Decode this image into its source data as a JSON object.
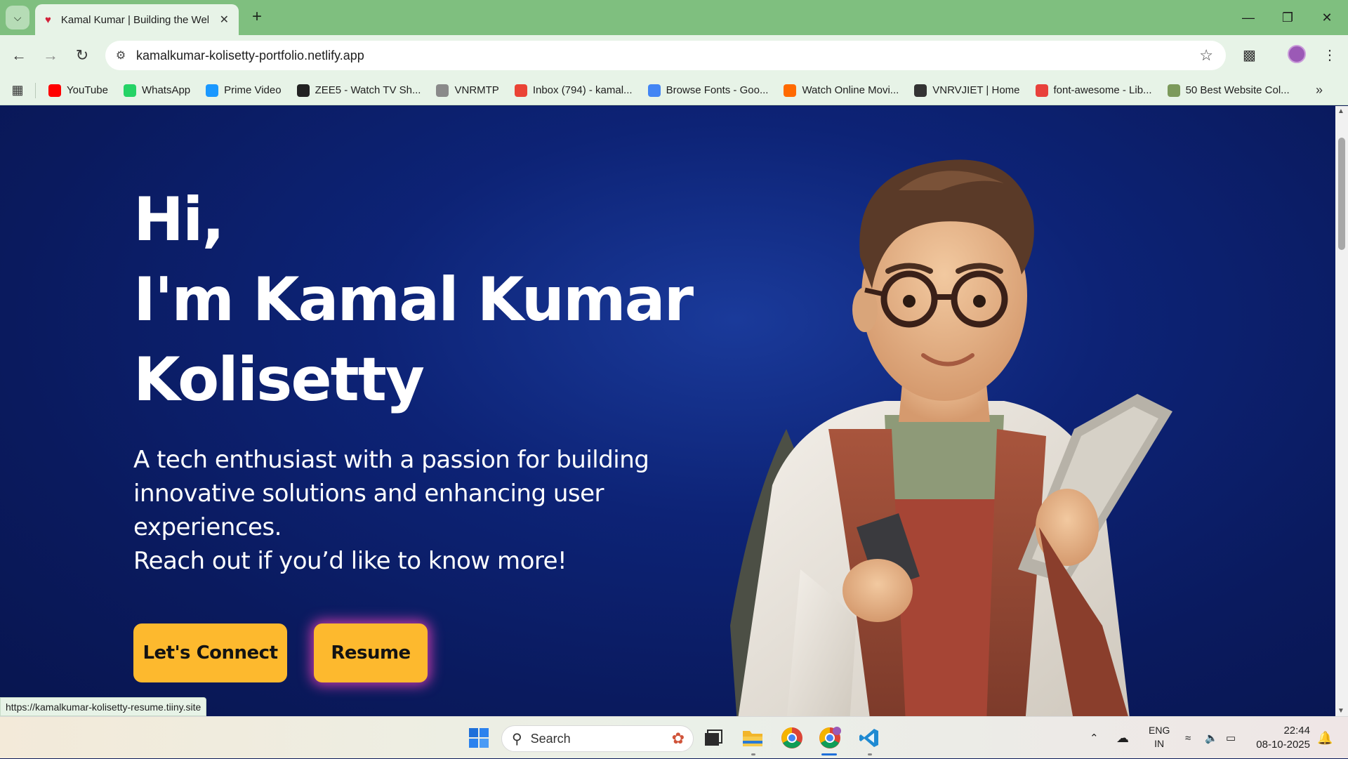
{
  "browser": {
    "tab_title": "Kamal Kumar | Building the Web",
    "url": "kamalkumar-kolisetty-portfolio.netlify.app",
    "status_url": "https://kamalkumar-kolisetty-resume.tiiny.site"
  },
  "bookmarks": [
    {
      "label": "YouTube",
      "icon": "youtube-icon",
      "color": "#ff0000"
    },
    {
      "label": "WhatsApp",
      "icon": "whatsapp-icon",
      "color": "#25d366"
    },
    {
      "label": "Prime Video",
      "icon": "prime-video-icon",
      "color": "#1a98ff"
    },
    {
      "label": "ZEE5 - Watch TV Sh...",
      "icon": "zee5-icon",
      "color": "#222222"
    },
    {
      "label": "VNRMTP",
      "icon": "vnrmtp-icon",
      "color": "#8a8a8a"
    },
    {
      "label": "Inbox (794) - kamal...",
      "icon": "gmail-icon",
      "color": "#ea4335"
    },
    {
      "label": "Browse Fonts - Goo...",
      "icon": "google-fonts-icon",
      "color": "#4285f4"
    },
    {
      "label": "Watch Online Movi...",
      "icon": "aha-icon",
      "color": "#ff6a00"
    },
    {
      "label": "VNRVJIET | Home",
      "icon": "vnrvjiet-icon",
      "color": "#333333"
    },
    {
      "label": "font-awesome - Lib...",
      "icon": "code-icon",
      "color": "#e8413b"
    },
    {
      "label": "50 Best Website Col...",
      "icon": "d-icon",
      "color": "#7c9a5b"
    }
  ],
  "hero": {
    "line1": "Hi,",
    "line2": "I'm Kamal Kumar",
    "line3": "Kolisetty",
    "description_1": "A tech enthusiast with a passion for building innovative solutions and enhancing user experiences.",
    "description_2": "Reach out if you’d like to know more!",
    "connect_label": "Let's Connect",
    "resume_label": "Resume"
  },
  "taskbar": {
    "search_placeholder": "Search",
    "lang_1": "ENG",
    "lang_2": "IN",
    "time": "22:44",
    "date": "08-10-2025"
  },
  "colors": {
    "accent": "#fdb92e",
    "page_bg": "#0d2376",
    "chrome_green": "#7fbf7f"
  }
}
